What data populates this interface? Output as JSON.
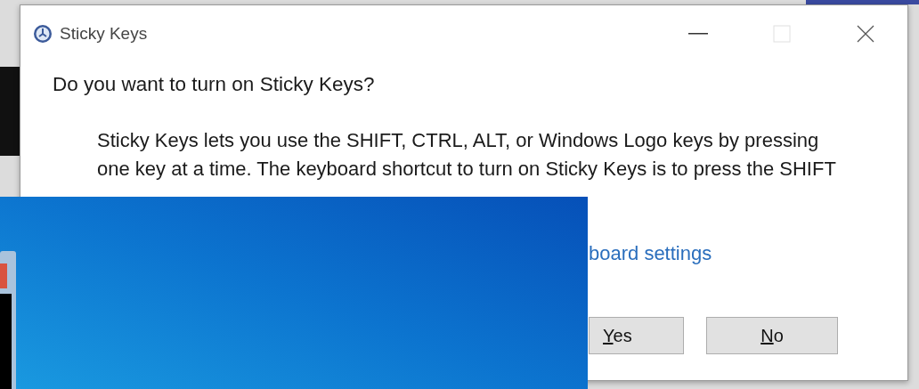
{
  "dialog": {
    "title": "Sticky Keys",
    "question": "Do you want to turn on Sticky Keys?",
    "description_lines": [
      "Sticky Keys lets you use the SHIFT, CTRL, ALT, or Windows Logo keys by pressing",
      "one key at a time. The keyboard shortcut to turn on Sticky Keys is to press the SHIFT"
    ],
    "link": "board settings",
    "buttons": [
      {
        "label": "Yes"
      },
      {
        "label": "No"
      }
    ]
  }
}
